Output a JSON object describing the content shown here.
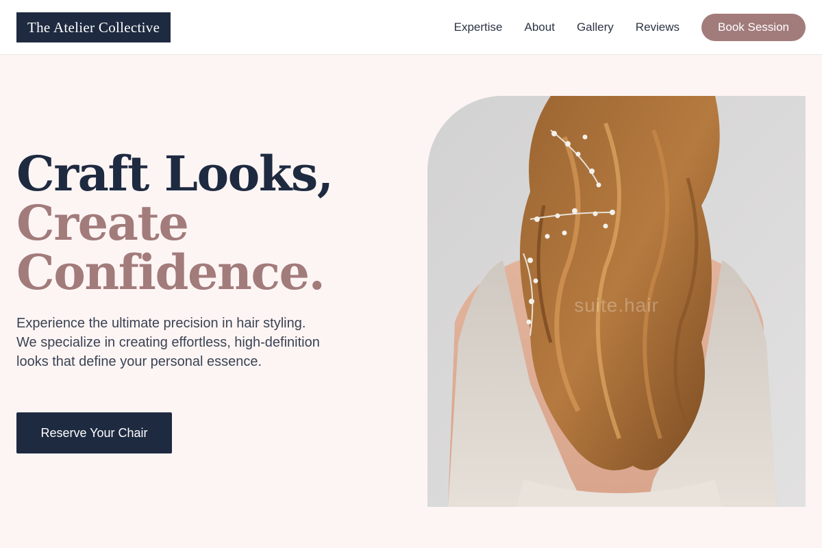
{
  "header": {
    "brand": "The Atelier Collective",
    "nav": [
      "Expertise",
      "About",
      "Gallery",
      "Reviews"
    ],
    "book_label": "Book Session"
  },
  "hero": {
    "headline_line1": "Craft Looks,",
    "headline_line2": "Create",
    "headline_line3": "Confidence.",
    "description": "Experience the ultimate precision in hair styling. We specialize in creating effortless, high-definition looks that define your personal essence.",
    "cta_label": "Reserve Your Chair"
  },
  "image": {
    "watermark": "suite.hair"
  },
  "colors": {
    "navy": "#1e2a40",
    "rose": "#a27b7b",
    "background": "#fdf5f4"
  }
}
